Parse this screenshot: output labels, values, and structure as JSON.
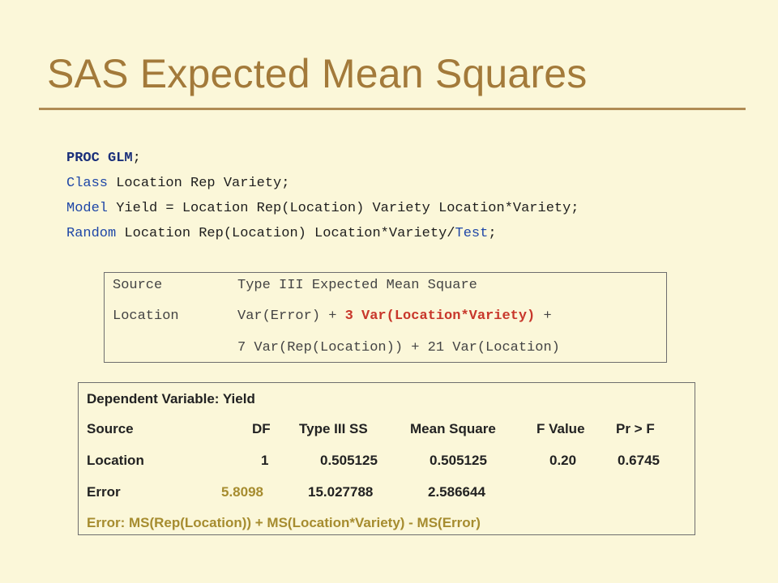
{
  "slide": {
    "title": "SAS Expected Mean Squares"
  },
  "code": {
    "l1_proc": "PROC GLM",
    "l1_end": ";",
    "l2_kw": "Class",
    "l2_rest": " Location Rep Variety;",
    "l3_kw": "Model",
    "l3_rest": " Yield = Location Rep(Location) Variety Location*Variety;",
    "l4_kw": "Random",
    "l4_rest": " Location Rep(Location) Location*Variety/",
    "l4_opt": "Test",
    "l4_end": ";"
  },
  "ems": {
    "h_source": "Source",
    "h_type": "Type III Expected Mean Square",
    "r_source": "Location",
    "r1_a": "Var(Error) + ",
    "r1_b": "3 Var(Location*Variety)",
    "r1_c": " +",
    "r2": "7 Var(Rep(Location)) + 21 Var(Location)"
  },
  "anova": {
    "dep": "Dependent Variable: Yield",
    "headers": [
      "Source",
      "DF",
      "Type III SS",
      "Mean Square",
      "F Value",
      "Pr > F"
    ],
    "loc": [
      "Location",
      "1",
      "0.505125",
      "0.505125",
      "0.20",
      "0.6745"
    ],
    "err": [
      "Error",
      "5.8098",
      "15.027788",
      "2.586644"
    ],
    "note": "Error: MS(Rep(Location)) + MS(Location*Variety) - MS(Error)"
  }
}
